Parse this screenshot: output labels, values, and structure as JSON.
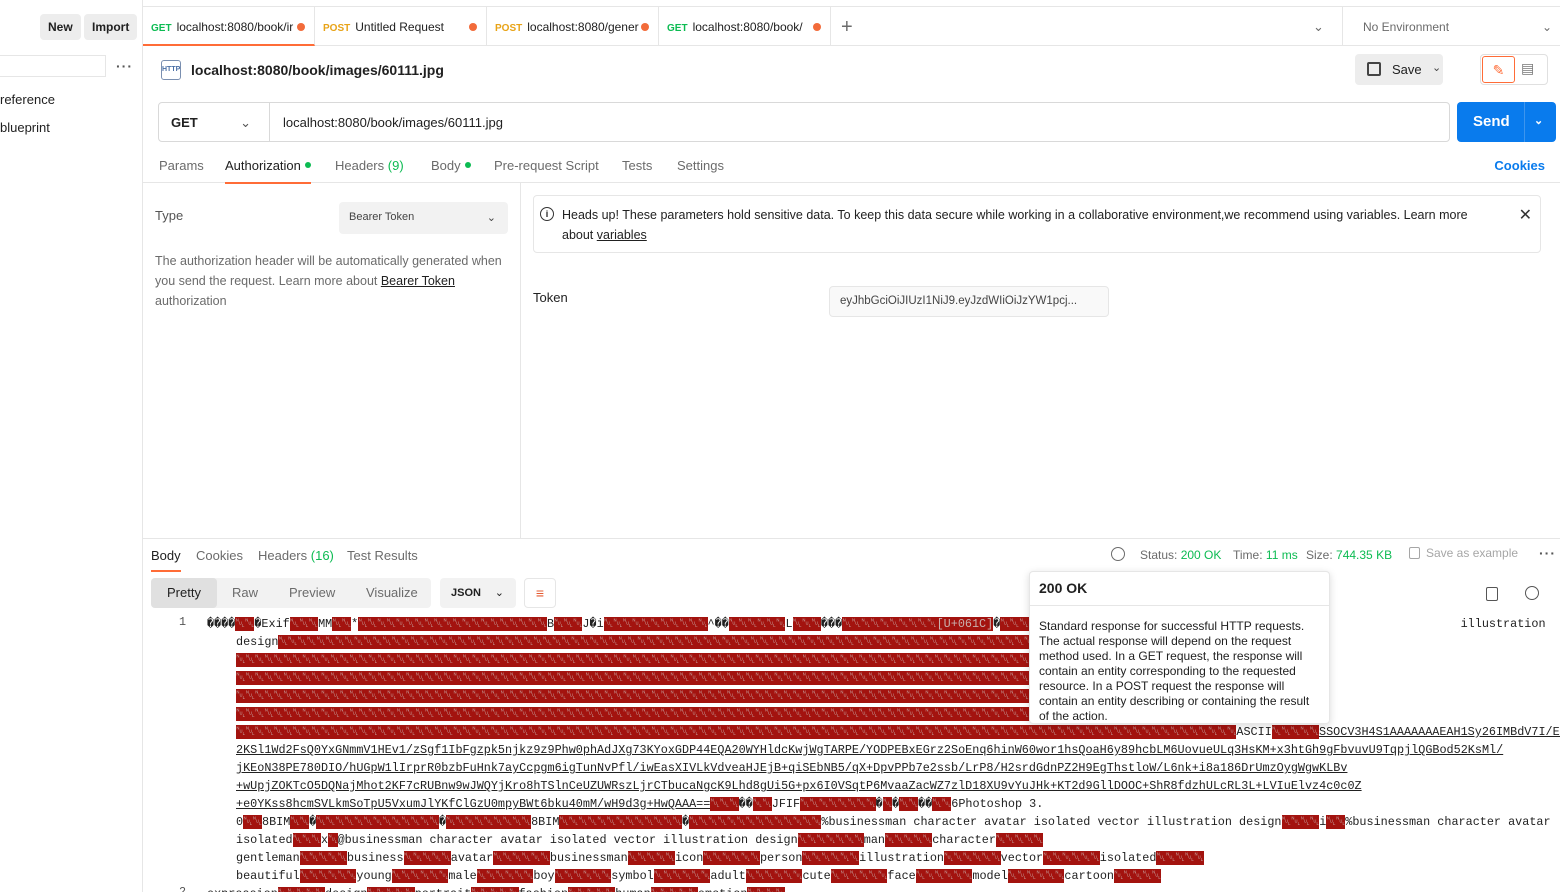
{
  "sidebar": {
    "new_label": "New",
    "import_label": "Import",
    "items": [
      {
        "label": "reference"
      },
      {
        "label": "blueprint"
      }
    ]
  },
  "tabs": [
    {
      "method": "GET",
      "title": "localhost:8080/book/ir",
      "method_color": "#0cbb52"
    },
    {
      "method": "POST",
      "title": "Untitled Request",
      "method_color": "#e8a317"
    },
    {
      "method": "POST",
      "title": "localhost:8080/gener",
      "method_color": "#e8a317"
    },
    {
      "method": "GET",
      "title": "localhost:8080/book/",
      "method_color": "#0cbb52"
    }
  ],
  "environment": "No Environment",
  "request": {
    "title": "localhost:8080/book/images/60111.jpg",
    "http_icon": "HTTP",
    "method": "GET",
    "url": "localhost:8080/book/images/60111.jpg",
    "save_label": "Save",
    "send_label": "Send"
  },
  "request_tabs": {
    "params": "Params",
    "authorization": "Authorization",
    "headers": "Headers",
    "headers_count": "(9)",
    "body": "Body",
    "pre_request": "Pre-request Script",
    "tests": "Tests",
    "settings": "Settings",
    "cookies": "Cookies"
  },
  "auth": {
    "type_label": "Type",
    "type_value": "Bearer Token",
    "desc_1": "The authorization header will be automatically generated when you send the request. Learn more about ",
    "desc_link": "Bearer Token",
    "desc_2": " authorization",
    "info_text": "Heads up! These parameters hold sensitive data. To keep this data secure while working in a collaborative environment,we recommend using variables. Learn more about ",
    "info_link": "variables",
    "token_label": "Token",
    "token_value": "eyJhbGciOiJIUzI1NiJ9.eyJzdWIiOiJzYW1pcj..."
  },
  "response": {
    "tabs": {
      "body": "Body",
      "cookies": "Cookies",
      "headers": "Headers",
      "headers_count": "(16)",
      "test_results": "Test Results"
    },
    "status_label": "Status:",
    "status_value": "200 OK",
    "time_label": "Time:",
    "time_value": "11 ms",
    "size_label": "Size:",
    "size_value": "744.35 KB",
    "save_example": "Save as example",
    "views": [
      "Pretty",
      "Raw",
      "Preview",
      "Visualize"
    ],
    "format": "JSON"
  },
  "tooltip": {
    "title": "200 OK",
    "body": "Standard response for successful HTTP requests. The actual response will depend on the request method used. In a GET request, the response will contain an entity corresponding to the requested resource. In a POST request the response will contain an entity describing or containing the result of the action."
  },
  "code": {
    "line_numbers": [
      "1",
      "2"
    ],
    "line_2_text": "2KSl1Wd2FsQ0YxGNmmV1HEv1/zSgf1IbFgzpk5njkz9z9Phw0phAdJXg73KYoxGDP44EQA20WYHldcKwjWgTARPE/YODPEBxEGrz2SoEnq6hinW60wor1hsQoaH6y89hcbLM6UovueULq3HsKM+x3htGh9gFbvuvU9TqpjlQGBod52KsMl/",
    "line_3_text": "jKEoN38PE780DIO/hUGpW1lIrprR0bzbFuHnk7ayCcpgm6igTunNvPfl/iwEasXIVLkVdveaHJEjB+qiSEbNB5/qX+DpvPPb7e2ssb/LrP8/H2srdGdnPZ2H9EgThstloW/L6nk+i8a186DrUmzOygWgwKLBv",
    "line_4_text": "+wUpjZOKTcO5DQNajMhot2KF7cRUBnw9wJWQYjKro8hTSlnCeUZUWRszLjrCTbucaNgcK9Lhd8gUi5G+px6I0VSqtP6MvaaZacWZ7zlD18XU9vYuJHk+KT2d9GllDOOC+ShR8fdzhULcRL3L+LVIuElvz4c0c0Z",
    "line_5_text": "+e0YKss8hcmSVLkmSoTpU5VxumJlYKfClGzU0mpyBWt6bku40mM/wH9d3g+HwQAAA==",
    "jfif": "JFIF",
    "photoshop": "6Photoshop 3.",
    "bim_1": "0",
    "bim_2": "8BIM",
    "bim_3": "8BIM",
    "bm_text_1": "%businessman character avatar isolated vector illustration design",
    "bm_text_2": "%businessman character avatar",
    "bm_text_3": "isolated",
    "bm_text_4": "@businessman character avatar isolated vector illustration design",
    "keywords_1": [
      "man",
      "character",
      "gentleman",
      "business",
      "avatar",
      "businessman",
      "icon",
      "person",
      "illustration",
      "vector",
      "isolated"
    ],
    "keywords_2": [
      "beautiful",
      "young",
      "male",
      "boy",
      "symbol",
      "adult",
      "cute",
      "face",
      "model",
      "cartoon"
    ],
    "line_1_head": "Exif",
    "line_1_mm": "MM",
    "line_1_tail": "illustration",
    "line_1_bus": "bus",
    "line_1_u": "[U+061C]",
    "line_1_ascii": "ASCII",
    "line_1_ascii_val": "SSOCV3H4S1AAAAAAAEAH1Sy26IMBdV7I/EHmdqDEYA/",
    "line_2_ascii": "design",
    "last_line": "expression",
    "last_line_2": "design",
    "last_line_3": "portrait",
    "last_line_4": "fashion",
    "last_line_5": "human",
    "last_line_6": "emotion"
  }
}
